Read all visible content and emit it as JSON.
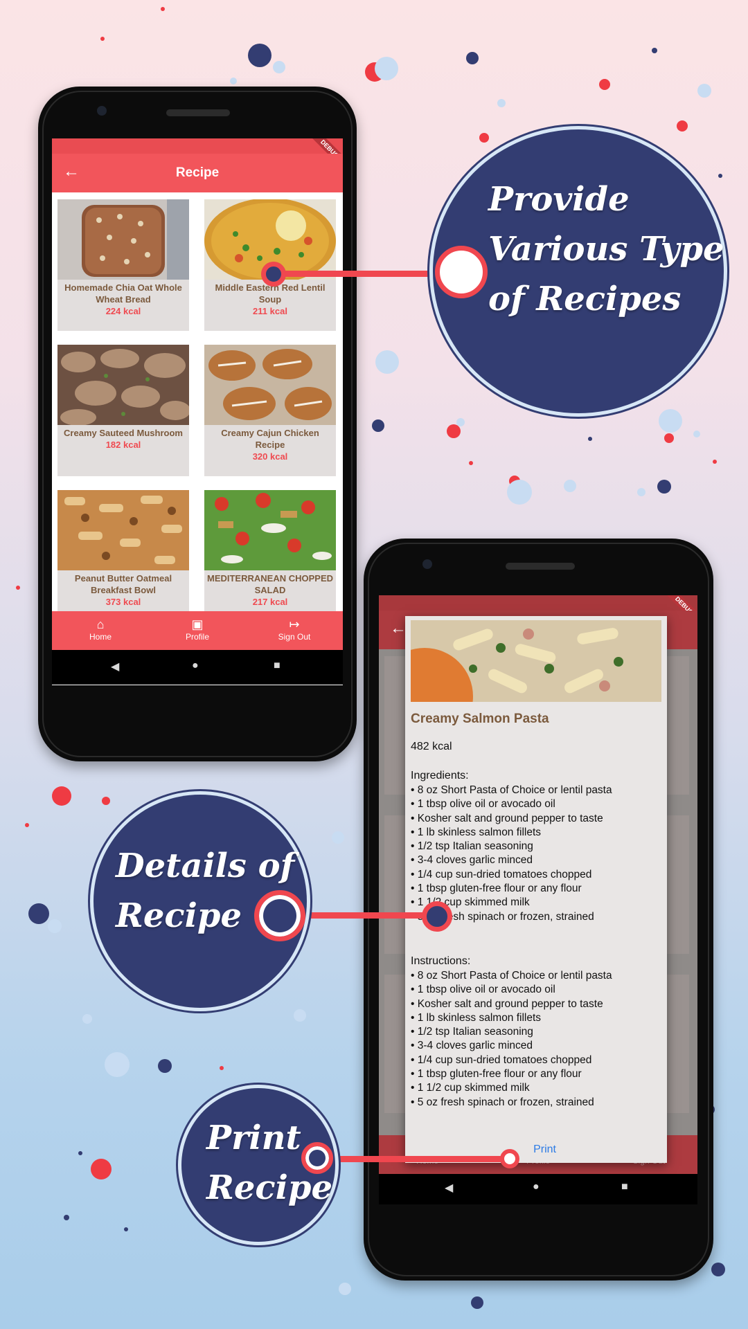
{
  "phone1": {
    "appbar_title": "Recipe",
    "recipes": [
      {
        "name": "Homemade Chia Oat Whole Wheat Bread",
        "kcal": "224 kcal"
      },
      {
        "name": "Middle Eastern Red Lentil Soup",
        "kcal": "211 kcal"
      },
      {
        "name": "Creamy Sauteed Mushroom",
        "kcal": "182 kcal"
      },
      {
        "name": "Creamy Cajun Chicken Recipe",
        "kcal": "320 kcal"
      },
      {
        "name": "Peanut Butter Oatmeal Breakfast Bowl",
        "kcal": "373 kcal"
      },
      {
        "name": "MEDITERRANEAN CHOPPED SALAD",
        "kcal": "217 kcal"
      }
    ],
    "nav": {
      "home": "Home",
      "profile": "Profile",
      "signout": "Sign Out"
    },
    "debug": "DEBUG"
  },
  "phone2": {
    "debug": "DEBUG",
    "nav": {
      "home": "Home",
      "profile": "Profile",
      "signout": "Sign Out"
    },
    "dialog": {
      "title": "Creamy Salmon Pasta",
      "kcal": "482 kcal",
      "ingredients_label": "Ingredients:",
      "ingredients": [
        "• 8 oz Short Pasta of Choice or lentil pasta",
        "• 1 tbsp olive oil or avocado oil",
        "• Kosher salt and ground pepper to taste",
        "• 1 lb skinless salmon fillets",
        "• 1/2 tsp Italian seasoning",
        "• 3-4 cloves garlic minced",
        "• 1/4 cup sun-dried tomatoes chopped",
        "• 1 tbsp gluten-free flour or any flour",
        "• 1 1/2 cup skimmed milk",
        "• 5 oz fresh spinach or frozen, strained"
      ],
      "instructions_label": "Instructions:",
      "instructions": [
        "• 8 oz Short Pasta of Choice or lentil pasta",
        "• 1 tbsp olive oil or avocado oil",
        "• Kosher salt and ground pepper to taste",
        "• 1 lb skinless salmon fillets",
        "• 1/2 tsp Italian seasoning",
        "• 3-4 cloves garlic minced",
        "• 1/4 cup sun-dried tomatoes chopped",
        "• 1 tbsp gluten-free flour or any flour",
        "• 1 1/2 cup skimmed milk",
        "• 5 oz fresh spinach or frozen, strained"
      ],
      "print": "Print"
    }
  },
  "callouts": {
    "recipes": [
      "Provide",
      "Various Type",
      "of Recipes"
    ],
    "details": [
      "Details of",
      "Recipe"
    ],
    "print": [
      "Print",
      "Recipe"
    ]
  },
  "colors": {
    "accent": "#f2555b",
    "navy": "#333d72",
    "connector": "#f0474f"
  },
  "icons": [
    "back-arrow-icon",
    "home-icon",
    "profile-icon",
    "sign-out-icon",
    "nav-back-icon",
    "nav-home-icon",
    "nav-recents-icon"
  ]
}
